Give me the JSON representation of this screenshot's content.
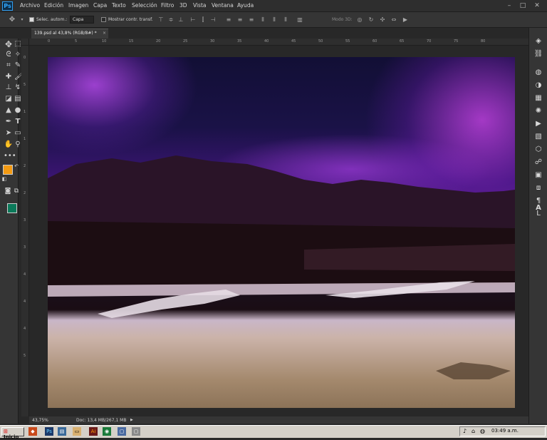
{
  "menubar": {
    "logo": "Ps",
    "items": [
      "Archivo",
      "Edición",
      "Imagen",
      "Capa",
      "Texto",
      "Selección",
      "Filtro",
      "3D",
      "Vista",
      "Ventana",
      "Ayuda"
    ],
    "window_controls": [
      "–",
      "□",
      "✕"
    ]
  },
  "options_bar": {
    "auto_select_label": "Selec. autom.:",
    "auto_select_value": "Capa",
    "transform_label": "Mostrar contr. transf.",
    "mode_3d_label": "Modo 3D:"
  },
  "document": {
    "tab_title": "139.psd al 43,8% (RGB/8#) *",
    "tab_close": "×"
  },
  "rulers": {
    "horizontal": [
      "0",
      "5",
      "10",
      "15",
      "20",
      "25",
      "30",
      "35",
      "40",
      "45",
      "50",
      "55",
      "60",
      "65",
      "70",
      "75",
      "80"
    ],
    "vertical": [
      "0",
      "5",
      "1",
      "1",
      "2",
      "2",
      "3",
      "3",
      "4",
      "4",
      "4",
      "5"
    ]
  },
  "status": {
    "zoom": "43,75%",
    "doc_size": "Doc: 13,4 MB/267,1 MB"
  },
  "colors": {
    "foreground": "#f39a12",
    "background": "#0b7a5a"
  },
  "tools": [
    "move-icon",
    "marquee-icon",
    "lasso-icon",
    "magic-wand-icon",
    "crop-icon",
    "eyedropper-icon",
    "healing-icon",
    "brush-icon",
    "stamp-icon",
    "history-brush-icon",
    "eraser-icon",
    "gradient-icon",
    "blur-icon",
    "dodge-icon",
    "pen-icon",
    "type-icon",
    "path-select-icon",
    "shape-icon",
    "hand-icon",
    "zoom-icon",
    "more-icon"
  ],
  "panels": [
    "layers-icon",
    "channels-icon",
    "adjustments-icon",
    "color-icon",
    "swatches-icon",
    "play-icon",
    "brush-panel-icon",
    "3d-panel-icon",
    "properties-icon",
    "library-icon",
    "paragraph-icon",
    "character-icon"
  ],
  "taskbar": {
    "start_label": "Inicio",
    "clock": "03:49 a.m."
  }
}
